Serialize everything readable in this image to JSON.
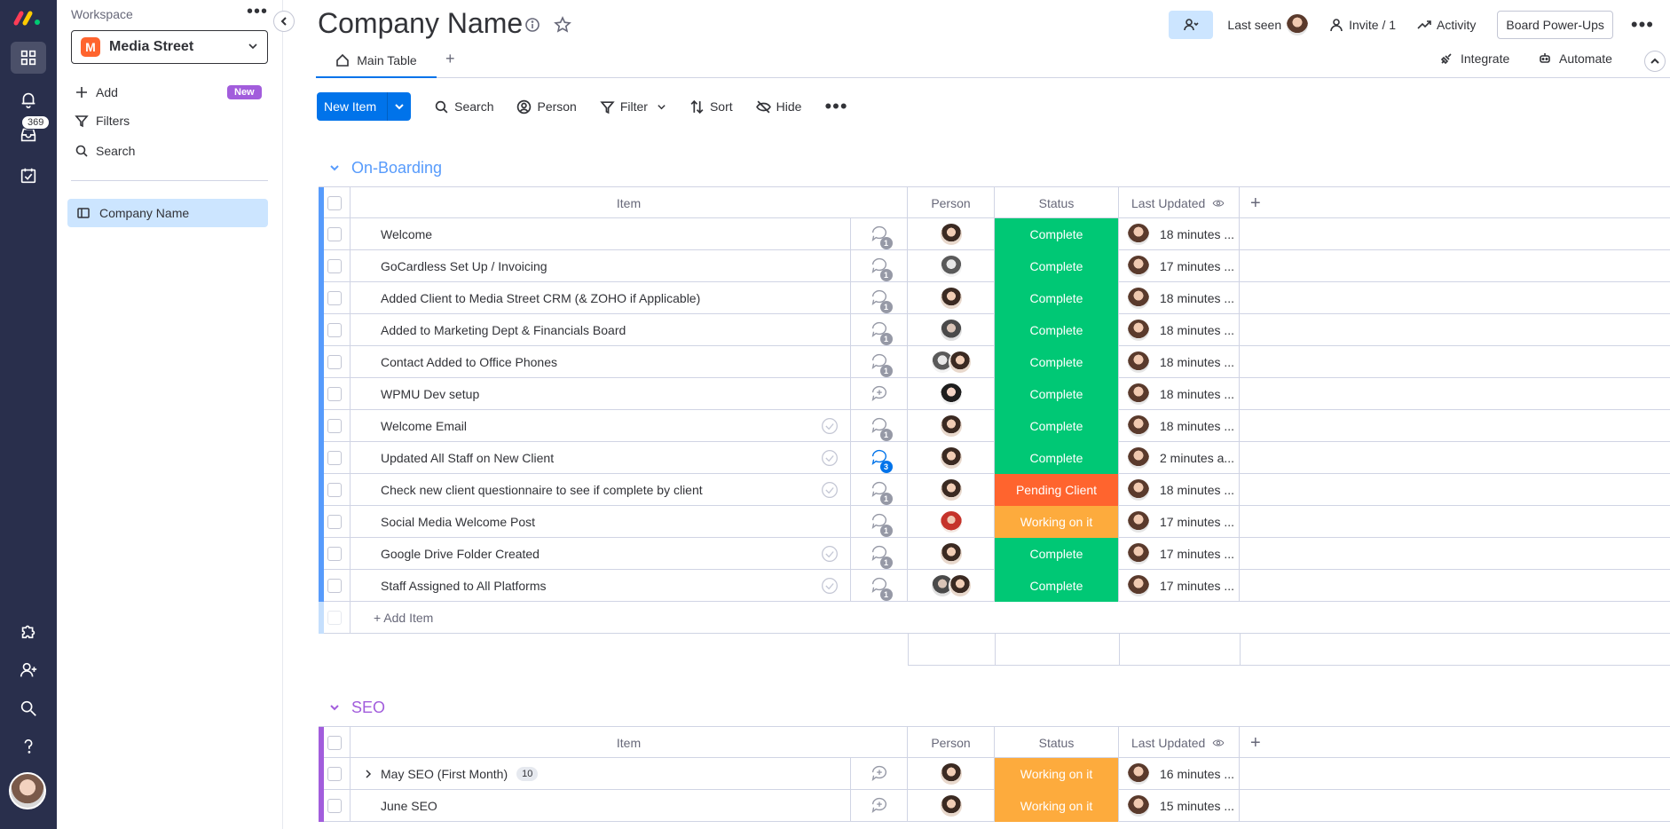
{
  "sidebar": {
    "workspace_label": "Workspace",
    "workspace_name": "Media Street",
    "workspace_initial": "M",
    "add_label": "Add",
    "new_badge": "New",
    "filters_label": "Filters",
    "search_label": "Search",
    "board_item": "Company Name",
    "inbox_count": "369"
  },
  "header": {
    "title": "Company Name",
    "last_seen": "Last seen",
    "invite": "Invite / 1",
    "activity": "Activity",
    "powerups": "Board Power-Ups",
    "tab_main": "Main Table",
    "tab_add": "+",
    "integrate": "Integrate",
    "automate": "Automate"
  },
  "toolbar": {
    "new_item": "New Item",
    "search": "Search",
    "person": "Person",
    "filter": "Filter",
    "sort": "Sort",
    "hide": "Hide"
  },
  "columns": {
    "item": "Item",
    "person": "Person",
    "status": "Status",
    "last_updated": "Last Updated"
  },
  "colors": {
    "complete": "#00c875",
    "pending": "#ff642e",
    "working": "#fdab3d",
    "onboarding": "#579bfc",
    "seo": "#a25ddc"
  },
  "groups": [
    {
      "name": "On-Boarding",
      "add_item": "+ Add Item",
      "rows": [
        {
          "name": "Welcome",
          "updates": "1",
          "status": "Complete",
          "last": "18 minutes ..."
        },
        {
          "name": "GoCardless Set Up / Invoicing",
          "updates": "1",
          "status": "Complete",
          "last": "17 minutes ..."
        },
        {
          "name": "Added Client to Media Street CRM (& ZOHO if Applicable)",
          "updates": "1",
          "status": "Complete",
          "last": "18 minutes ..."
        },
        {
          "name": "Added to Marketing Dept & Financials Board",
          "updates": "1",
          "status": "Complete",
          "last": "18 minutes ..."
        },
        {
          "name": "Contact Added to Office Phones",
          "updates": "1",
          "status": "Complete",
          "last": "18 minutes ..."
        },
        {
          "name": "WPMU Dev setup",
          "updates": "",
          "status": "Complete",
          "last": "18 minutes ..."
        },
        {
          "name": "Welcome Email",
          "updates": "1",
          "status": "Complete",
          "last": "18 minutes ..."
        },
        {
          "name": "Updated All Staff on New Client",
          "updates": "3",
          "status": "Complete",
          "last": "2 minutes a..."
        },
        {
          "name": "Check new client questionnaire to see if complete by client",
          "updates": "1",
          "status": "Pending Client",
          "last": "18 minutes ..."
        },
        {
          "name": "Social Media Welcome Post",
          "updates": "1",
          "status": "Working on it",
          "last": "17 minutes ..."
        },
        {
          "name": "Google Drive Folder Created",
          "updates": "1",
          "status": "Complete",
          "last": "17 minutes ..."
        },
        {
          "name": "Staff Assigned to All Platforms",
          "updates": "1",
          "status": "Complete",
          "last": "17 minutes ..."
        }
      ]
    },
    {
      "name": "SEO",
      "rows": [
        {
          "name": "May SEO (First Month)",
          "subitems": "10",
          "status": "Working on it",
          "last": "16 minutes ..."
        },
        {
          "name": "June SEO",
          "status": "Working on it",
          "last": "15 minutes ..."
        }
      ]
    }
  ]
}
